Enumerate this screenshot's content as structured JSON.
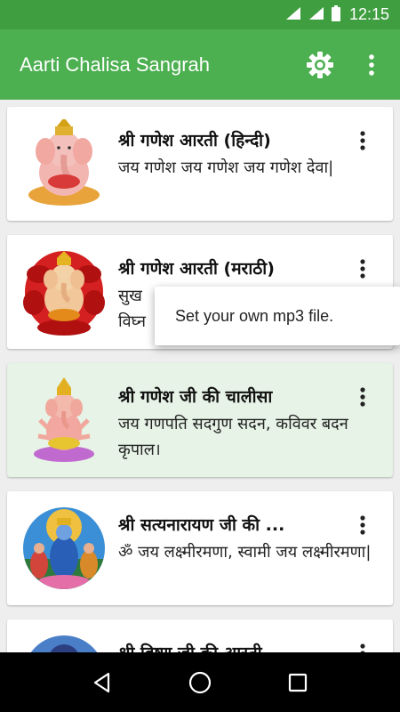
{
  "status_bar": {
    "time": "12:15",
    "icons": [
      "signal-icon",
      "roaming-icon",
      "battery-icon"
    ]
  },
  "app_bar": {
    "title": "Aarti Chalisa Sangrah",
    "actions": [
      "gear-icon",
      "overflow-menu-icon"
    ],
    "background": "#4caf50"
  },
  "items": [
    {
      "title": "श्री गणेश आरती (हिन्दी)",
      "desc": "जय गणेश जय गणेश जय गणेश देवा|"
    },
    {
      "title": "श्री गणेश आरती (मराठी)",
      "desc_line1": "सुख",
      "desc_line2": "विघ्न"
    },
    {
      "title": "श्री गणेश जी की चालीसा",
      "desc": "जय गणपति सदगुण सदन, कविवर बदन कृपाल।"
    },
    {
      "title": "श्री सत्यनारायण जी की ...",
      "desc": "ॐ जय लक्ष्मीरमणा, स्वामी जय लक्ष्मीरमणा|"
    },
    {
      "title": "श्री विष्णु जी की आरती",
      "desc": ""
    }
  ],
  "popup_menu": {
    "item": "Set your own mp3 file."
  },
  "nav_bar": {
    "buttons": [
      "back-icon",
      "home-icon",
      "recents-icon"
    ]
  }
}
